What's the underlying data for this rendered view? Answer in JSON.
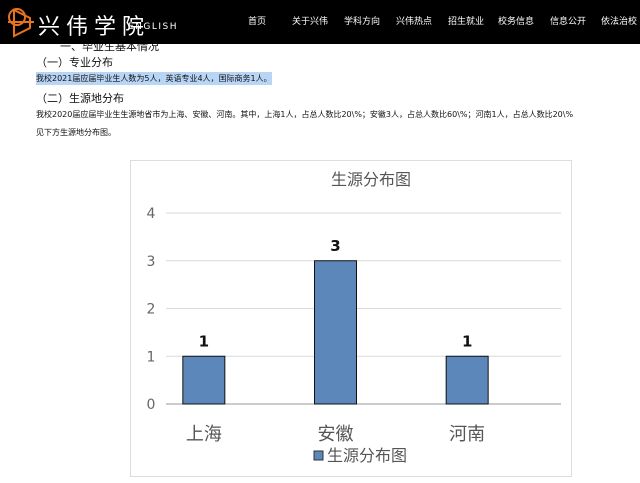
{
  "header": {
    "brand": "兴伟学院",
    "english": "ENGLISH",
    "nav": [
      "首页",
      "关于兴伟",
      "学科方向",
      "兴伟热点",
      "招生就业",
      "校务信息",
      "信息公开",
      "依法治校"
    ]
  },
  "content": {
    "cut_heading": "一、毕业生基本情况",
    "h1": "（一）专业分布",
    "p1": "我校2021届应届毕业生人数为5人，英语专业4人，国际商务1人。",
    "h2": "（二）生源地分布",
    "p2": "我校2020届应届毕业生生源地省市为上海、安徽、河南。其中，上海1人，占总人数比20\\%；安徽3人，占总人数比60\\%；河南1人，占总人数比20\\%",
    "p3": "见下方生源地分布图。"
  },
  "chart_data": {
    "type": "bar",
    "title": "生源分布图",
    "categories": [
      "上海",
      "安徽",
      "河南"
    ],
    "values": [
      1,
      3,
      1
    ],
    "ylim": [
      0,
      4
    ],
    "yticks": [
      "0",
      "1",
      "2",
      "3",
      "4"
    ],
    "legend": "生源分布图",
    "legend_position": "bottom",
    "color": "#5b87bb"
  }
}
